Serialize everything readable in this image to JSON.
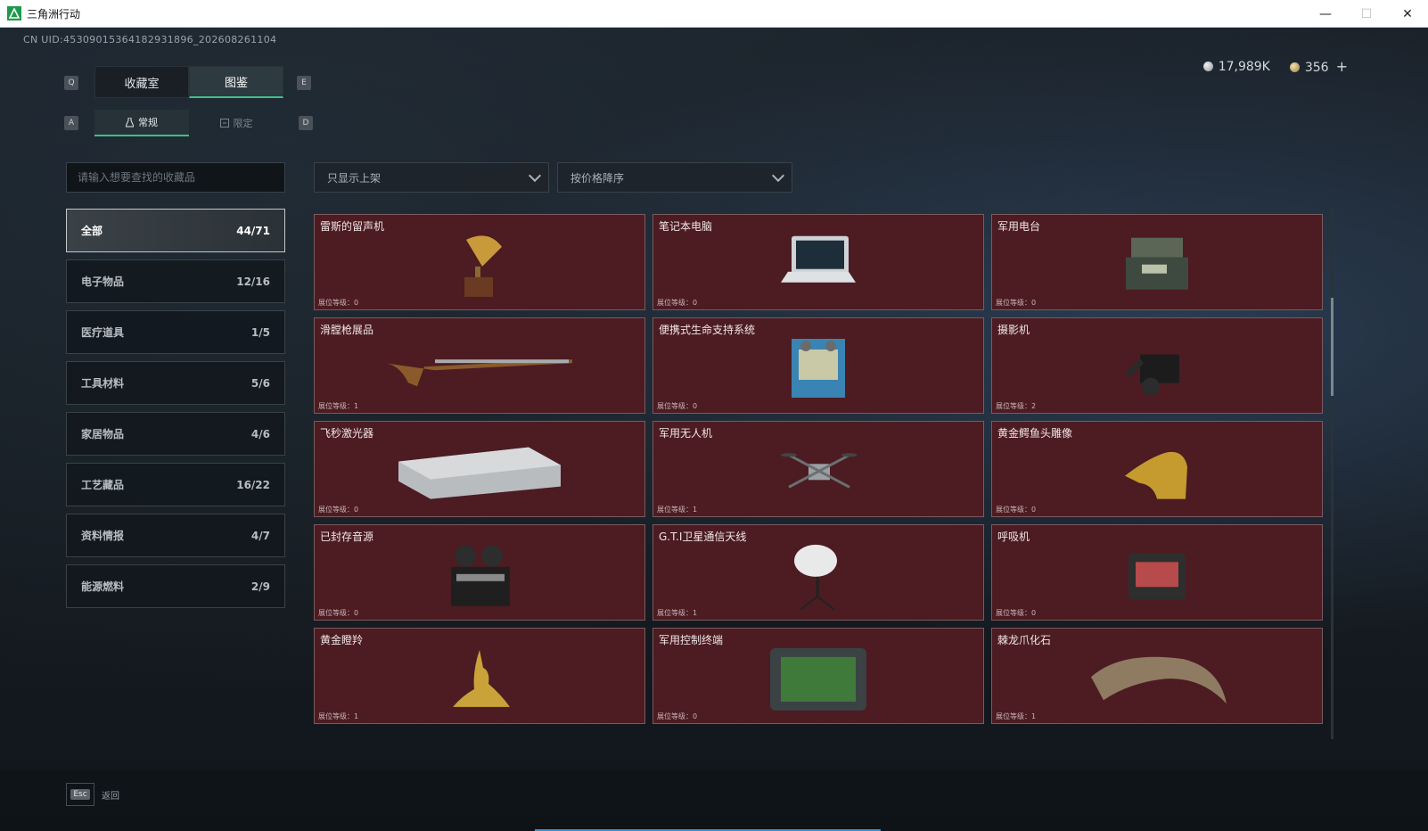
{
  "window": {
    "title": "三角洲行动",
    "minimize_glyph": "—",
    "maximize_glyph": "☐",
    "close_glyph": "✕"
  },
  "header": {
    "uid": "CN UID:45309015364182931896_202608261104",
    "currency": [
      {
        "icon": "silver-coin-icon",
        "value": "17,989K"
      },
      {
        "icon": "gold-coin-icon",
        "value": "356"
      }
    ],
    "plus": "+"
  },
  "keys": {
    "q": "Q",
    "e": "E",
    "a": "A",
    "d": "D"
  },
  "tabs": {
    "main": [
      {
        "label": "收藏室"
      },
      {
        "label": "图鉴"
      }
    ],
    "sub": [
      {
        "label": "常规"
      },
      {
        "label": "限定"
      }
    ]
  },
  "search": {
    "placeholder": "请输入想要查找的收藏品"
  },
  "filters": {
    "availability": "只显示上架",
    "sort": "按价格降序"
  },
  "categories": [
    {
      "label": "全部",
      "count": "44/71"
    },
    {
      "label": "电子物品",
      "count": "12/16"
    },
    {
      "label": "医疗道具",
      "count": "1/5"
    },
    {
      "label": "工具材料",
      "count": "5/6"
    },
    {
      "label": "家居物品",
      "count": "4/6"
    },
    {
      "label": "工艺藏品",
      "count": "16/22"
    },
    {
      "label": "资料情报",
      "count": "4/7"
    },
    {
      "label": "能源燃料",
      "count": "2/9"
    }
  ],
  "items": [
    {
      "name": "雷斯的留声机",
      "level": "展位等级：0",
      "icon": "gramophone-icon"
    },
    {
      "name": "笔记本电脑",
      "level": "展位等级：0",
      "icon": "laptop-icon"
    },
    {
      "name": "军用电台",
      "level": "展位等级：0",
      "icon": "military-radio-icon"
    },
    {
      "name": "滑膛枪展品",
      "level": "展位等级：1",
      "icon": "musket-icon"
    },
    {
      "name": "便携式生命支持系统",
      "level": "展位等级：0",
      "icon": "life-support-icon"
    },
    {
      "name": "摄影机",
      "level": "展位等级：2",
      "icon": "camera-icon"
    },
    {
      "name": "飞秒激光器",
      "level": "展位等级：0",
      "icon": "laser-case-icon"
    },
    {
      "name": "军用无人机",
      "level": "展位等级：1",
      "icon": "drone-icon"
    },
    {
      "name": "黄金鳄鱼头雕像",
      "level": "展位等级：0",
      "icon": "crocodile-statue-icon"
    },
    {
      "name": "已封存音源",
      "level": "展位等级：0",
      "icon": "reel-recorder-icon"
    },
    {
      "name": "G.T.I卫星通信天线",
      "level": "展位等级：1",
      "icon": "satellite-dish-icon"
    },
    {
      "name": "呼吸机",
      "level": "展位等级：0",
      "icon": "ventilator-icon"
    },
    {
      "name": "黄金瞪羚",
      "level": "展位等级：1",
      "icon": "gold-gazelle-icon"
    },
    {
      "name": "军用控制终端",
      "level": "展位等级：0",
      "icon": "control-terminal-icon"
    },
    {
      "name": "棘龙爪化石",
      "level": "展位等级：1",
      "icon": "claw-fossil-icon"
    }
  ],
  "footer": {
    "esc_key": "Esc",
    "esc_label": "返回"
  },
  "colors": {
    "card_bg": "#4c1c22",
    "accent": "#3fbf8a"
  }
}
